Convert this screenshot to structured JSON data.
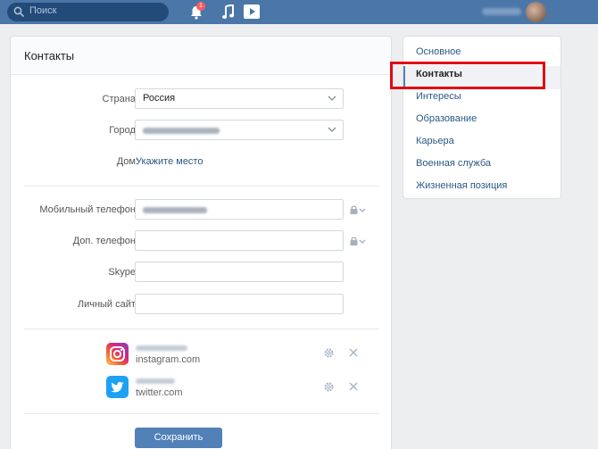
{
  "header": {
    "search_placeholder": "Поиск",
    "notification_count": "1",
    "accent": "#4a76a8"
  },
  "main": {
    "title": "Контакты",
    "country_label": "Страна:",
    "country_value": "Россия",
    "city_label": "Город:",
    "home_label": "Дом:",
    "home_link": "Укажите место",
    "mobile_label": "Мобильный телефон:",
    "extra_phone_label": "Доп. телефон:",
    "skype_label": "Skype:",
    "site_label": "Личный сайт:",
    "services": [
      {
        "icon": "instagram-icon",
        "domain": "instagram.com"
      },
      {
        "icon": "twitter-icon",
        "domain": "twitter.com"
      }
    ],
    "save_label": "Сохранить"
  },
  "nav": {
    "items": [
      {
        "label": "Основное"
      },
      {
        "label": "Контакты",
        "active": true
      },
      {
        "label": "Интересы"
      },
      {
        "label": "Образование"
      },
      {
        "label": "Карьера"
      },
      {
        "label": "Военная служба"
      },
      {
        "label": "Жизненная позиция"
      }
    ]
  },
  "colors": {
    "link": "#2a5885",
    "button": "#5181b8",
    "highlight": "#e30613"
  }
}
